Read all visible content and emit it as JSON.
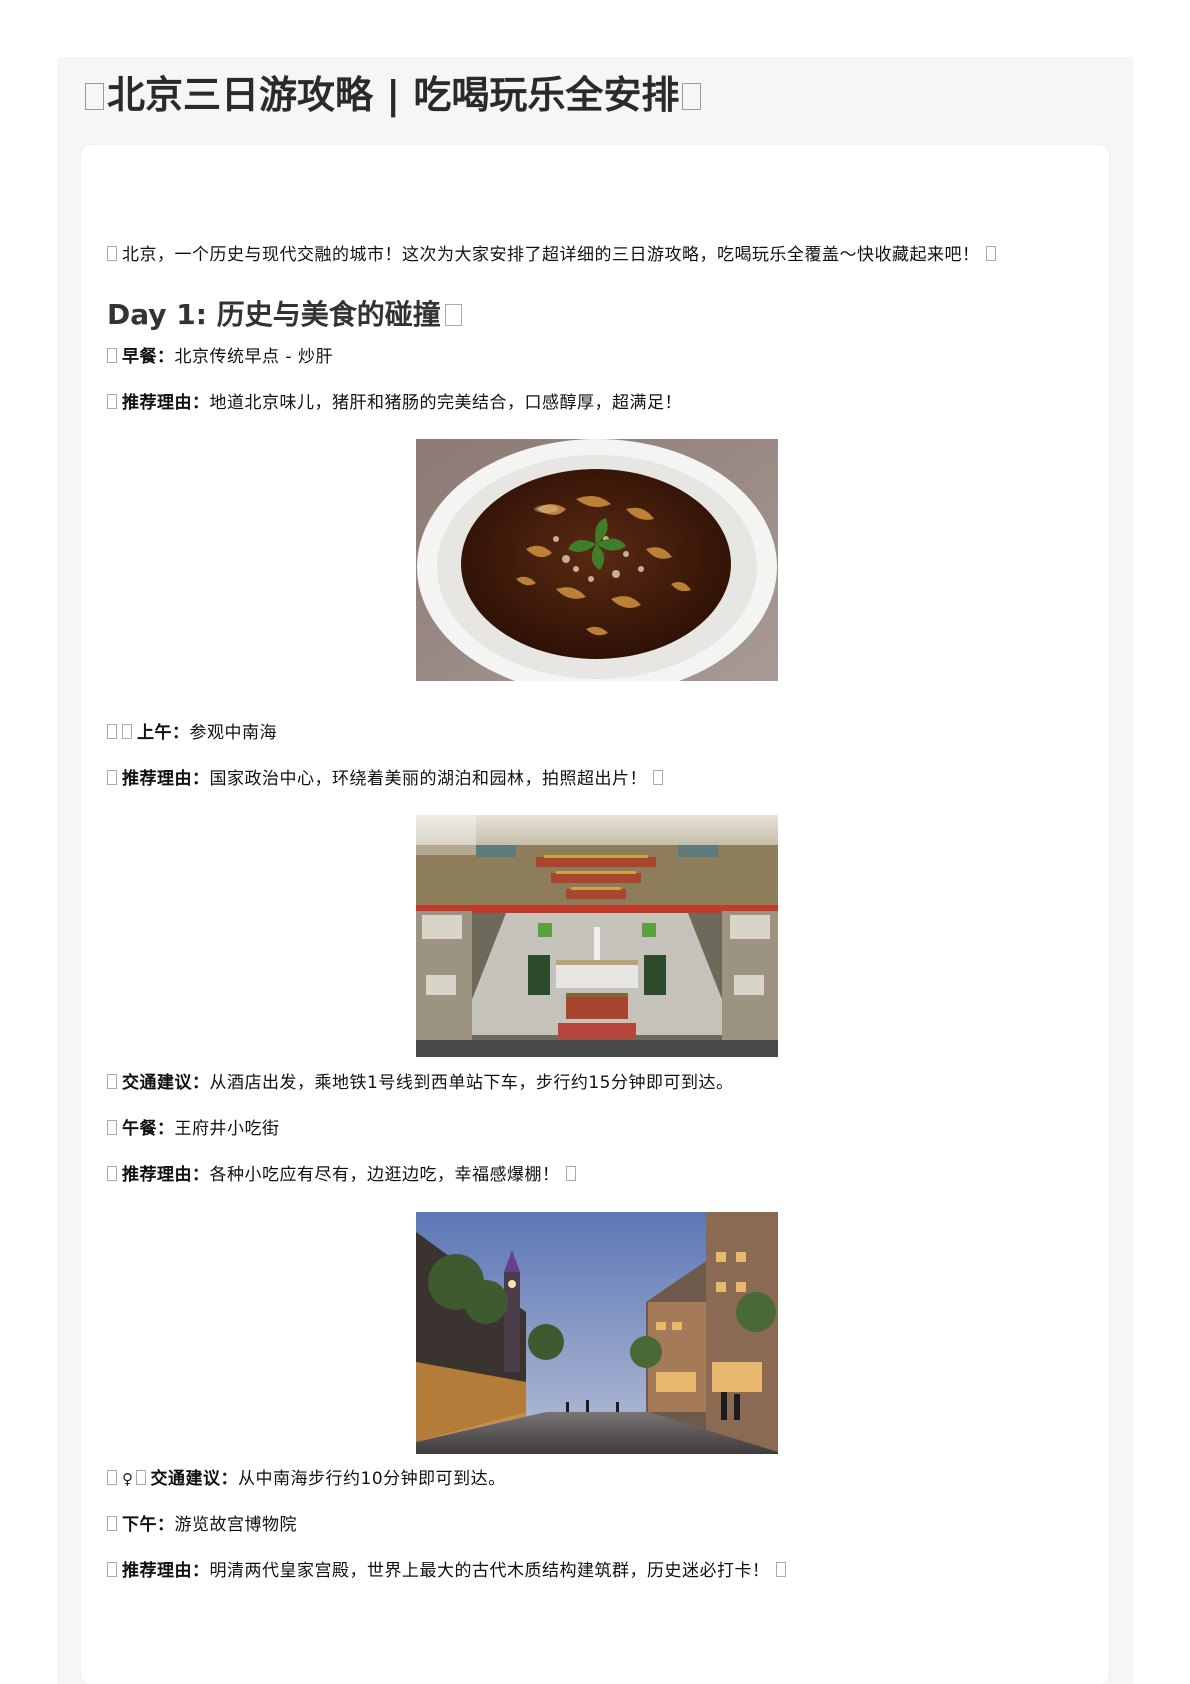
{
  "title": "北京三日游攻略 | 吃喝玩乐全安排",
  "intro": "北京，一个历史与现代交融的城市！这次为大家安排了超详细的三日游攻略，吃喝玩乐全覆盖～快收藏起来吧！",
  "day1": {
    "heading": "Day 1: 历史与美食的碰撞",
    "items": [
      {
        "label": "早餐：",
        "text": "北京传统早点 - 炒肝"
      },
      {
        "label": "推荐理由：",
        "text": "地道北京味儿，猪肝和猪肠的完美结合，口感醇厚，超满足！"
      },
      {
        "label": "上午：",
        "text": "参观中南海"
      },
      {
        "label": "推荐理由：",
        "text": "国家政治中心，环绕着美丽的湖泊和园林，拍照超出片！"
      },
      {
        "label": "交通建议：",
        "text": "从酒店出发，乘地铁1号线到西单站下车，步行约15分钟即可到达。"
      },
      {
        "label": "午餐：",
        "text": "王府井小吃街"
      },
      {
        "label": "推荐理由：",
        "text": "各种小吃应有尽有，边逛边吃，幸福感爆棚！"
      },
      {
        "label": "交通建议：",
        "text": "从中南海步行约10分钟即可到达。",
        "glyph": "♀"
      },
      {
        "label": "下午：",
        "text": "游览故宫博物院"
      },
      {
        "label": "推荐理由：",
        "text": "明清两代皇家宫殿，世界上最大的古代木质结构建筑群，历史迷必打卡！"
      }
    ]
  },
  "images": [
    {
      "icon": "chaogan-soup-photo"
    },
    {
      "icon": "palace-aerial-photo"
    },
    {
      "icon": "wangfujing-street-photo"
    }
  ]
}
